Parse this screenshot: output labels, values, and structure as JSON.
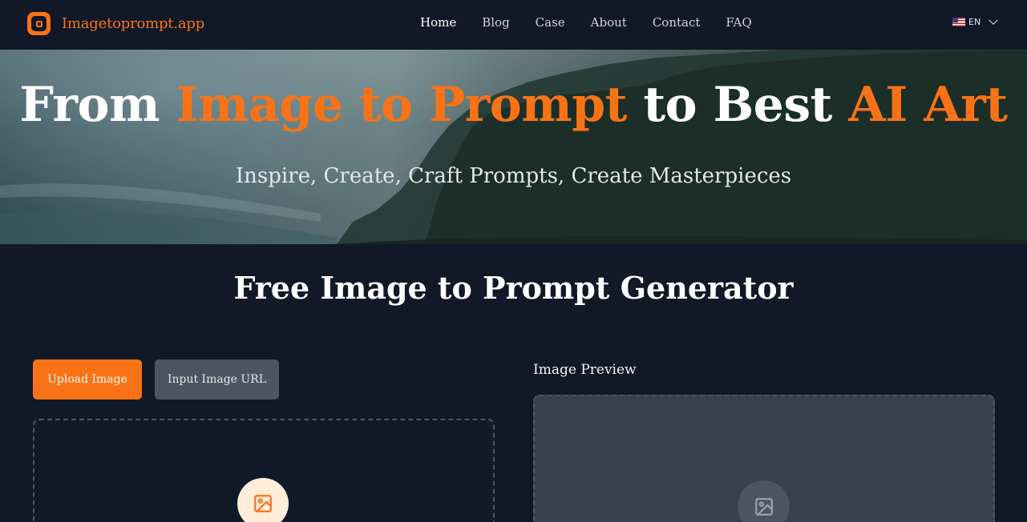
{
  "header": {
    "logo_text": "Imagetoprompt.app",
    "logo_icon": "app-logo-icon",
    "nav": [
      {
        "label": "Home",
        "active": true
      },
      {
        "label": "Blog",
        "active": false
      },
      {
        "label": "Case",
        "active": false
      },
      {
        "label": "About",
        "active": false
      },
      {
        "label": "Contact",
        "active": false
      },
      {
        "label": "FAQ",
        "active": false
      }
    ],
    "language": {
      "flag": "us-flag-icon",
      "code": "EN",
      "chevron": "chevron-down-icon"
    }
  },
  "hero": {
    "title_parts": [
      "From ",
      "Image to Prompt",
      " to Best ",
      "AI Art"
    ],
    "subtitle": "Inspire, Create, Craft Prompts, Create Masterpieces"
  },
  "generator": {
    "title": "Free Image to Prompt Generator",
    "upload_button": "Upload Image",
    "url_button": "Input Image URL",
    "upload_icon": "image-icon",
    "preview_label": "Image Preview",
    "preview_icon": "image-icon"
  },
  "colors": {
    "accent": "#f97316",
    "background": "#111827",
    "secondary_button": "#4b5563",
    "preview_bg": "#374151"
  }
}
